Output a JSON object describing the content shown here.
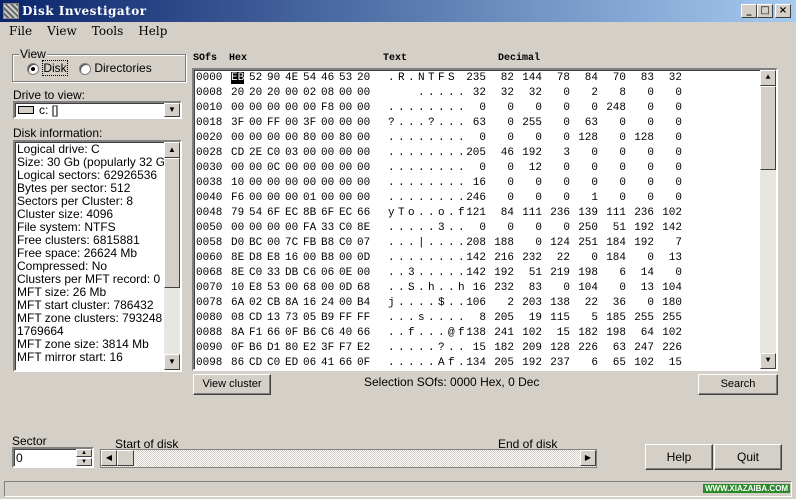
{
  "window": {
    "title": "Disk Investigator",
    "buttons": [
      "_",
      "□",
      "×"
    ]
  },
  "menu": [
    "File",
    "View",
    "Tools",
    "Help"
  ],
  "view": {
    "label": "View",
    "options": [
      {
        "label": "Disk",
        "selected": true
      },
      {
        "label": "Directories",
        "selected": false
      }
    ]
  },
  "drive": {
    "label": "Drive to view:",
    "value": "c: []",
    "icon": "drive-icon"
  },
  "disk_info": {
    "label": "Disk information:",
    "lines": [
      "Logical drive: C",
      "Size: 30 Gb (popularly 32 Gb)",
      "Logical sectors: 62926536",
      "Bytes per sector: 512",
      "Sectors per Cluster: 8",
      "Cluster size: 4096",
      "File system: NTFS",
      "Free clusters: 6815881",
      "Free space: 26624 Mb",
      "Compressed: No",
      "Clusters per MFT record: 0",
      "MFT size: 26 Mb",
      "MFT start cluster: 786432",
      "MFT zone clusters: 793248 -",
      "1769664",
      "MFT zone size: 3814 Mb",
      "MFT mirror start: 16"
    ]
  },
  "hex": {
    "headers": {
      "offset": "SOfs",
      "hex": "Hex",
      "text": "Text",
      "decimal": "Decimal"
    },
    "selected_byte": {
      "row": 0,
      "col": 0
    },
    "rows": [
      {
        "ofs": "0000",
        "hex": [
          "EB",
          "52",
          "90",
          "4E",
          "54",
          "46",
          "53",
          "20"
        ],
        "text": ".R.NTFS ",
        "dec": [
          235,
          82,
          144,
          78,
          84,
          70,
          83,
          32
        ]
      },
      {
        "ofs": "0008",
        "hex": [
          "20",
          "20",
          "20",
          "00",
          "02",
          "08",
          "00",
          "00"
        ],
        "text": "   .....",
        "dec": [
          32,
          32,
          32,
          0,
          2,
          8,
          0,
          0
        ]
      },
      {
        "ofs": "0010",
        "hex": [
          "00",
          "00",
          "00",
          "00",
          "00",
          "F8",
          "00",
          "00"
        ],
        "text": "........",
        "dec": [
          0,
          0,
          0,
          0,
          0,
          248,
          0,
          0
        ]
      },
      {
        "ofs": "0018",
        "hex": [
          "3F",
          "00",
          "FF",
          "00",
          "3F",
          "00",
          "00",
          "00"
        ],
        "text": "?...?...",
        "dec": [
          63,
          0,
          255,
          0,
          63,
          0,
          0,
          0
        ]
      },
      {
        "ofs": "0020",
        "hex": [
          "00",
          "00",
          "00",
          "00",
          "80",
          "00",
          "80",
          "00"
        ],
        "text": "........",
        "dec": [
          0,
          0,
          0,
          0,
          128,
          0,
          128,
          0
        ]
      },
      {
        "ofs": "0028",
        "hex": [
          "CD",
          "2E",
          "C0",
          "03",
          "00",
          "00",
          "00",
          "00"
        ],
        "text": "........",
        "dec": [
          205,
          46,
          192,
          3,
          0,
          0,
          0,
          0
        ]
      },
      {
        "ofs": "0030",
        "hex": [
          "00",
          "00",
          "0C",
          "00",
          "00",
          "00",
          "00",
          "00"
        ],
        "text": "........",
        "dec": [
          0,
          0,
          12,
          0,
          0,
          0,
          0,
          0
        ]
      },
      {
        "ofs": "0038",
        "hex": [
          "10",
          "00",
          "00",
          "00",
          "00",
          "00",
          "00",
          "00"
        ],
        "text": "........",
        "dec": [
          16,
          0,
          0,
          0,
          0,
          0,
          0,
          0
        ]
      },
      {
        "ofs": "0040",
        "hex": [
          "F6",
          "00",
          "00",
          "00",
          "01",
          "00",
          "00",
          "00"
        ],
        "text": "........",
        "dec": [
          246,
          0,
          0,
          0,
          1,
          0,
          0,
          0
        ]
      },
      {
        "ofs": "0048",
        "hex": [
          "79",
          "54",
          "6F",
          "EC",
          "8B",
          "6F",
          "EC",
          "66"
        ],
        "text": "yTo..o.f",
        "dec": [
          121,
          84,
          111,
          236,
          139,
          111,
          236,
          102
        ]
      },
      {
        "ofs": "0050",
        "hex": [
          "00",
          "00",
          "00",
          "00",
          "FA",
          "33",
          "C0",
          "8E"
        ],
        "text": ".....3..",
        "dec": [
          0,
          0,
          0,
          0,
          250,
          51,
          192,
          142
        ]
      },
      {
        "ofs": "0058",
        "hex": [
          "D0",
          "BC",
          "00",
          "7C",
          "FB",
          "B8",
          "C0",
          "07"
        ],
        "text": "...|....",
        "dec": [
          208,
          188,
          0,
          124,
          251,
          184,
          192,
          7
        ]
      },
      {
        "ofs": "0060",
        "hex": [
          "8E",
          "D8",
          "E8",
          "16",
          "00",
          "B8",
          "00",
          "0D"
        ],
        "text": "........",
        "dec": [
          142,
          216,
          232,
          22,
          0,
          184,
          0,
          13
        ]
      },
      {
        "ofs": "0068",
        "hex": [
          "8E",
          "C0",
          "33",
          "DB",
          "C6",
          "06",
          "0E",
          "00"
        ],
        "text": "..3.....",
        "dec": [
          142,
          192,
          51,
          219,
          198,
          6,
          14,
          0
        ]
      },
      {
        "ofs": "0070",
        "hex": [
          "10",
          "E8",
          "53",
          "00",
          "68",
          "00",
          "0D",
          "68"
        ],
        "text": "..S.h..h",
        "dec": [
          16,
          232,
          83,
          0,
          104,
          0,
          13,
          104
        ]
      },
      {
        "ofs": "0078",
        "hex": [
          "6A",
          "02",
          "CB",
          "8A",
          "16",
          "24",
          "00",
          "B4"
        ],
        "text": "j....$..",
        "dec": [
          106,
          2,
          203,
          138,
          22,
          36,
          0,
          180
        ]
      },
      {
        "ofs": "0080",
        "hex": [
          "08",
          "CD",
          "13",
          "73",
          "05",
          "B9",
          "FF",
          "FF"
        ],
        "text": "...s....",
        "dec": [
          8,
          205,
          19,
          115,
          5,
          185,
          255,
          255
        ]
      },
      {
        "ofs": "0088",
        "hex": [
          "8A",
          "F1",
          "66",
          "0F",
          "B6",
          "C6",
          "40",
          "66"
        ],
        "text": "..f...@f",
        "dec": [
          138,
          241,
          102,
          15,
          182,
          198,
          64,
          102
        ]
      },
      {
        "ofs": "0090",
        "hex": [
          "0F",
          "B6",
          "D1",
          "80",
          "E2",
          "3F",
          "F7",
          "E2"
        ],
        "text": ".....?..",
        "dec": [
          15,
          182,
          209,
          128,
          226,
          63,
          247,
          226
        ]
      },
      {
        "ofs": "0098",
        "hex": [
          "86",
          "CD",
          "C0",
          "ED",
          "06",
          "41",
          "66",
          "0F"
        ],
        "text": ".....Af.",
        "dec": [
          134,
          205,
          192,
          237,
          6,
          65,
          102,
          15
        ]
      }
    ]
  },
  "actions": {
    "view_cluster": "View cluster",
    "selection": "Selection SOfs: 0000 Hex,  0 Dec",
    "search": "Search"
  },
  "sector": {
    "label": "Sector",
    "value": "0",
    "start_label": "Start of disk",
    "end_label": "End of disk",
    "position": 0
  },
  "buttons": {
    "help": "Help",
    "quit": "Quit"
  },
  "watermark": "WWW.XIAZAIBA.COM",
  "colors": {
    "title_start": "#0a246a",
    "title_end": "#a6caf0",
    "face": "#d4d0c8",
    "selection": "#000000"
  }
}
